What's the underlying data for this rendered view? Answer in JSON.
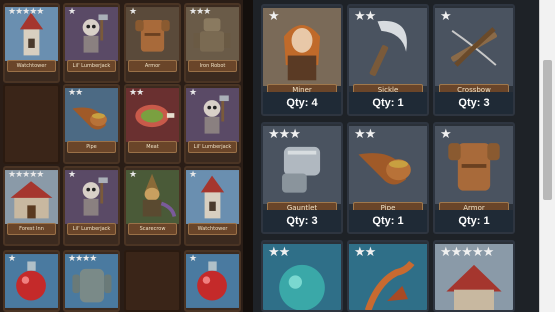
{
  "inventory": {
    "cards": [
      {
        "name": "Watchtower",
        "stars": "★★★★★",
        "star_color": "#e8e8e8",
        "bg": "#6a8fb0"
      },
      {
        "name": "Lil' Lumberjack",
        "stars": "★",
        "star_color": "#e8e8e8",
        "bg": "#5a4a66"
      },
      {
        "name": "Armor",
        "stars": "★",
        "star_color": "#e8e8e8",
        "bg": "#5a4a3a"
      },
      {
        "name": "Iron Robot",
        "stars": "★★★",
        "star_color": "#e8e8e8",
        "bg": "#6a5b48"
      },
      {
        "name": "Pipe",
        "stars": "★★",
        "star_color": "#e8e8e8",
        "bg": "#4c6a84"
      },
      {
        "name": "Meat",
        "stars": "★★",
        "star_color": "#e8e8e8",
        "bg": "#6a3030"
      },
      {
        "name": "Lil' Lumberjack",
        "stars": "★",
        "star_color": "#e8e8e8",
        "bg": "#5a4a66"
      },
      {
        "name": "Forest Inn",
        "stars": "★★★★★",
        "star_color": "#e8e8e8",
        "bg": "#8a9aa8"
      },
      {
        "name": "Lil' Lumberjack",
        "stars": "★",
        "star_color": "#e8e8e8",
        "bg": "#5a4a66"
      },
      {
        "name": "Scarecrow",
        "stars": "★",
        "star_color": "#e8e8e8",
        "bg": "#4a5a38"
      },
      {
        "name": "Watchtower",
        "stars": "★",
        "star_color": "#e8e8e8",
        "bg": "#6a8fb0"
      },
      {
        "name": "",
        "stars": "★",
        "star_color": "#e8e8e8",
        "bg": "#4a7aa0"
      },
      {
        "name": "",
        "stars": "★★★★",
        "star_color": "#e8e8e8",
        "bg": "#4a7aa0"
      },
      {
        "name": "",
        "stars": "★",
        "star_color": "#e8e8e8",
        "bg": "#4a7aa0"
      }
    ]
  },
  "collection": {
    "cards": [
      {
        "name": "Miner",
        "stars": "★",
        "qty": "Qty: 4",
        "bg": "#7a6a58"
      },
      {
        "name": "Sickle",
        "stars": "★★",
        "qty": "Qty: 1",
        "bg": "#4a5360"
      },
      {
        "name": "Crossbow",
        "stars": "★",
        "qty": "Qty: 3",
        "bg": "#4a5360"
      },
      {
        "name": "Gauntlet",
        "stars": "★★★",
        "qty": "Qty: 3",
        "bg": "#4a5360"
      },
      {
        "name": "Pipe",
        "stars": "★★",
        "qty": "Qty: 1",
        "bg": "#4a5360"
      },
      {
        "name": "Armor",
        "stars": "★",
        "qty": "Qty: 1",
        "bg": "#4a5360"
      },
      {
        "name": "",
        "stars": "★★",
        "qty": "",
        "bg": "#2f6f88"
      },
      {
        "name": "",
        "stars": "★★",
        "qty": "",
        "bg": "#2f6f88"
      },
      {
        "name": "",
        "stars": "★★★★★",
        "qty": "",
        "bg": "#8a9aa8"
      }
    ]
  }
}
